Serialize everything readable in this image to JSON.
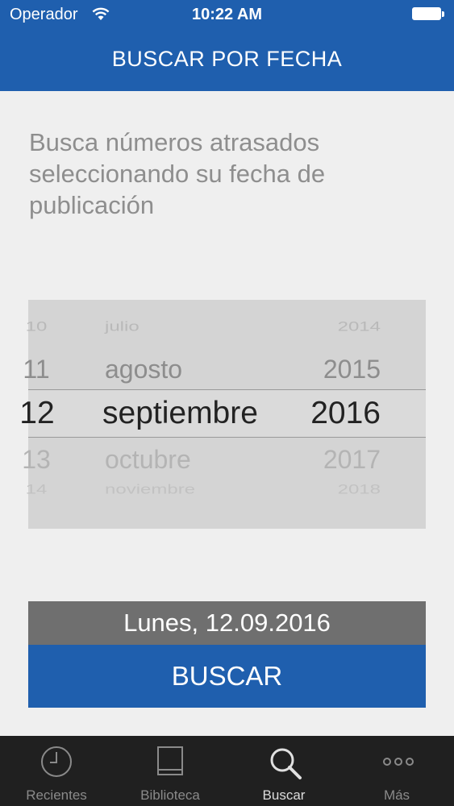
{
  "status_bar": {
    "carrier": "Operador",
    "time": "10:22 AM"
  },
  "nav": {
    "title": "BUSCAR POR FECHA"
  },
  "intro_text": "Busca números atrasados seleccionando su fecha de publicación",
  "picker": {
    "rows": [
      {
        "day": "10",
        "month": "julio",
        "year": "2014"
      },
      {
        "day": "11",
        "month": "agosto",
        "year": "2015"
      },
      {
        "day": "12",
        "month": "septiembre",
        "year": "2016"
      },
      {
        "day": "13",
        "month": "octubre",
        "year": "2017"
      },
      {
        "day": "14",
        "month": "noviembre",
        "year": "2018"
      }
    ]
  },
  "selected_date": "Lunes, 12.09.2016",
  "search_button": "BUSCAR",
  "tabbar": {
    "tabs": [
      {
        "label": "Recientes",
        "icon": "clock-icon"
      },
      {
        "label": "Biblioteca",
        "icon": "book-icon"
      },
      {
        "label": "Buscar",
        "icon": "search-icon"
      },
      {
        "label": "Más",
        "icon": "more-icon"
      }
    ],
    "active": "Buscar"
  },
  "colors": {
    "brand_blue": "#1f5fae",
    "date_bar": "#6f6f6f",
    "tabbar": "#202020"
  }
}
